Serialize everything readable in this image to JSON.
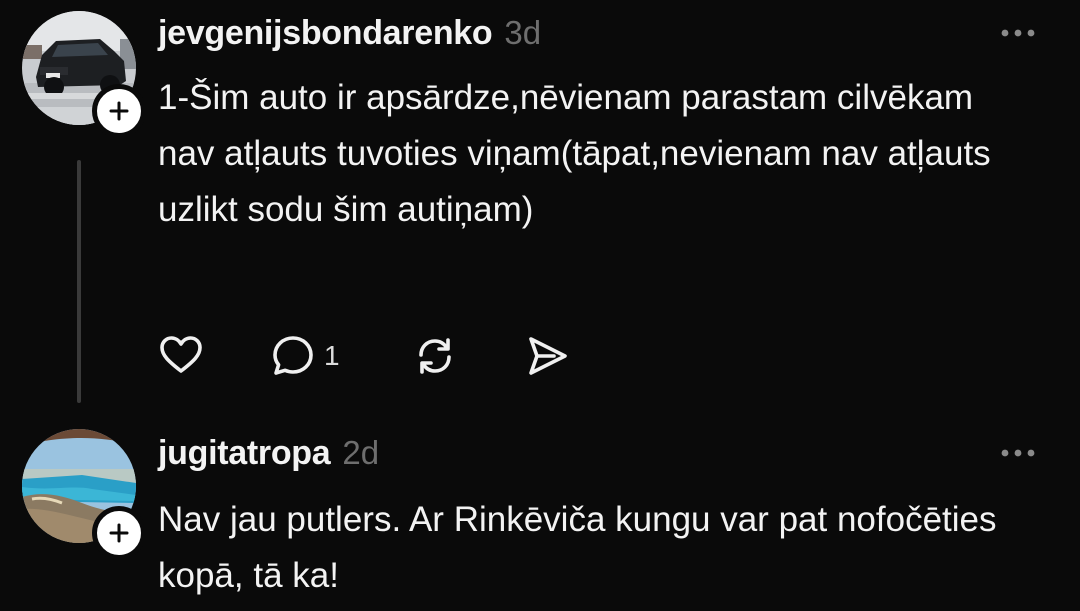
{
  "colors": {
    "background": "#0a0a0a",
    "text_primary": "#f3f3f3",
    "text_secondary": "#6e6e6e",
    "thread_line": "#3a3a3a"
  },
  "posts": [
    {
      "username": "jevgenijsbondarenko",
      "time": "3d",
      "text": "1-Šim auto ir apsārdze,nēvienam parastam cilvēkam nav atļauts tuvoties viņam(tāpat,nevienam nav atļauts uzlikt sodu šim autiņam)",
      "avatar_icon": "suv-photo",
      "actions": {
        "like_icon": "heart-icon",
        "reply_icon": "comment-icon",
        "reply_count": "1",
        "repost_icon": "repost-icon",
        "share_icon": "send-icon"
      }
    },
    {
      "username": "jugitatropa",
      "time": "2d",
      "text": "Nav jau putlers. Ar Rinkēviča kungu var pat nofočēties kopā, tā ka!",
      "avatar_icon": "coast-photo"
    }
  ]
}
